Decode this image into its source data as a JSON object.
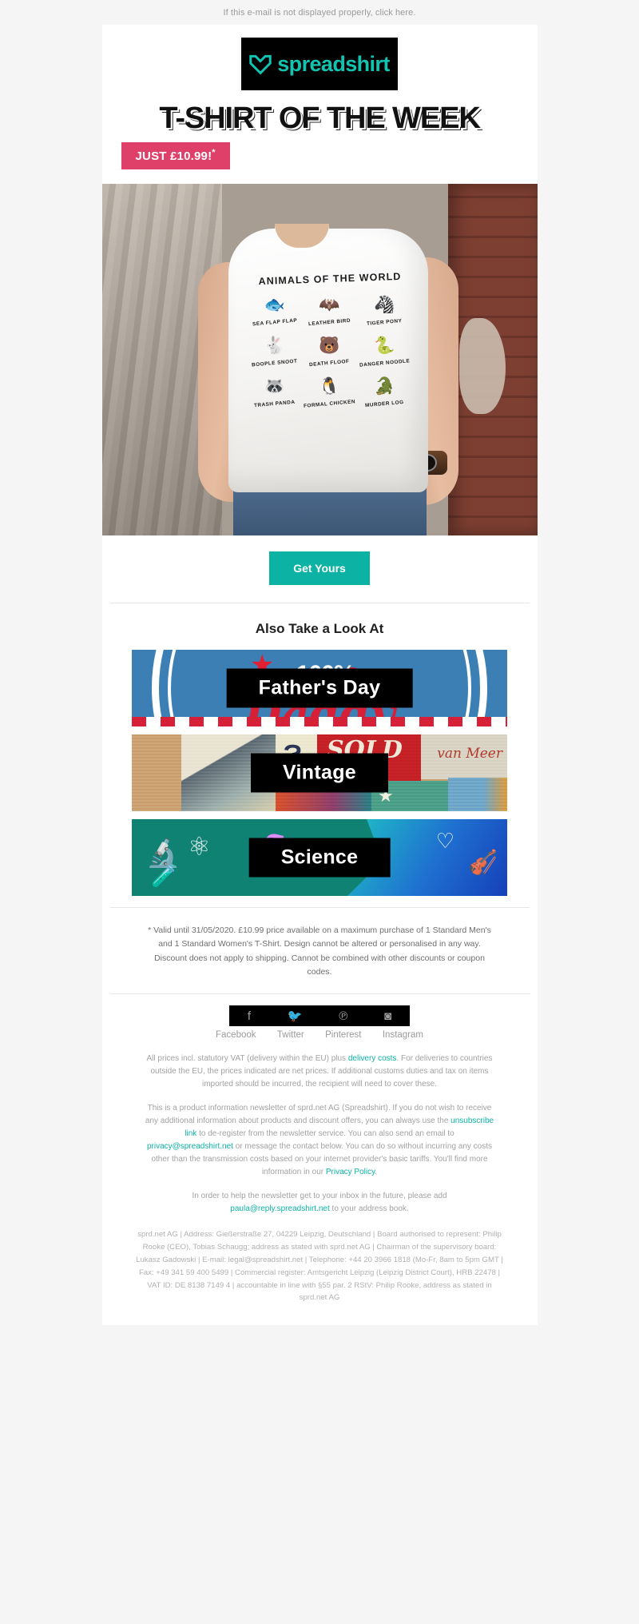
{
  "preheader": {
    "text": "If this e-mail is not displayed properly, ",
    "link": "click here."
  },
  "brand": {
    "name": "spreadshirt",
    "logo_icon": "spreadshirt-heart-logo",
    "accent_teal": "#0cb3a4",
    "accent_pink": "#de4069"
  },
  "hero": {
    "headline": "T-SHIRT OF THE WEEK",
    "badge": "JUST £10.99!",
    "badge_asterisk": "*",
    "cta_label": "Get Yours",
    "shirt_print": {
      "title": "ANIMALS OF THE WORLD",
      "items": [
        {
          "label": "SEA FLAP FLAP",
          "icon": "stingray-icon",
          "glyph": "🐟"
        },
        {
          "label": "LEATHER BIRD",
          "icon": "bat-icon",
          "glyph": "🦇"
        },
        {
          "label": "TIGER PONY",
          "icon": "zebra-icon",
          "glyph": "🦓"
        },
        {
          "label": "BOOPLE SNOOT",
          "icon": "rabbit-icon",
          "glyph": "🐇"
        },
        {
          "label": "DEATH FLOOF",
          "icon": "bear-icon",
          "glyph": "🐻"
        },
        {
          "label": "DANGER NOODLE",
          "icon": "snake-icon",
          "glyph": "🐍"
        },
        {
          "label": "TRASH PANDA",
          "icon": "raccoon-icon",
          "glyph": "🦝"
        },
        {
          "label": "FORMAL CHICKEN",
          "icon": "penguin-icon",
          "glyph": "🐧"
        },
        {
          "label": "MURDER LOG",
          "icon": "crocodile-icon",
          "glyph": "🐊"
        }
      ]
    }
  },
  "also": {
    "title": "Also Take a Look At",
    "banners": [
      {
        "label": "Father's Day",
        "art": "fathers-day",
        "art_text": "100%",
        "script_text": "Daddy",
        "bg": "#3b7fb5"
      },
      {
        "label": "Vintage",
        "art": "vintage-collage",
        "bg": "#cda272"
      },
      {
        "label": "Science",
        "art": "science-doodles",
        "bg": "#0f8273"
      }
    ]
  },
  "disclaimer": "* Valid until 31/05/2020. £10.99 price available on a maximum purchase of 1 Standard Men's and 1 Standard Women's T-Shirt. Design cannot be altered or personalised in any way. Discount does not apply to shipping. Cannot be combined with other discounts or coupon codes.",
  "social": [
    {
      "name": "Facebook",
      "icon": "facebook-icon",
      "glyph": "f"
    },
    {
      "name": "Twitter",
      "icon": "twitter-icon",
      "glyph": "🐦"
    },
    {
      "name": "Pinterest",
      "icon": "pinterest-icon",
      "glyph": "℗"
    },
    {
      "name": "Instagram",
      "icon": "instagram-icon",
      "glyph": "◙"
    }
  ],
  "footer": {
    "vat_1": "All prices incl. statutory VAT (delivery within the EU) plus ",
    "vat_link": "delivery costs",
    "vat_2": ". For deliveries to countries outside the EU, the prices indicated are net prices. If additional customs duties and tax on items imported should be incurred, the recipient will need to cover these.",
    "news_1": "This is a product information newsletter of sprd.net AG (Spreadshirt). If you do not wish to receive any additional information about products and discount offers, you can always use the ",
    "news_link_1": "unsubscribe link",
    "news_2": " to de-register from the newsletter service. You can also send an email to ",
    "news_link_2": "privacy@spreadshirt.net",
    "news_3": " or message the contact below. You can do so without incurring any costs other than the transmission costs based on your internet provider's basic tariffs. You'll find more information in our ",
    "news_link_3": "Privacy Policy",
    "news_4": ".",
    "inbox_1": "In order to help the newsletter get to your inbox in the future, please add ",
    "inbox_link": "paula@reply.spreadshirt.net",
    "inbox_2": " to your address book.",
    "legal": "sprd.net AG | Address: Gießerstraße 27, 04229 Leipzig, Deutschland | Board authorised to represent: Philip Rooke (CEO), Tobias Schaugg; address as stated with sprd.net AG | Chairman of the supervisory board: Lukasz Gadowski | E-mail: legal@spreadshirt.net | Telephone: +44 20 3966 1818 (Mo-Fr, 8am to 5pm GMT | Fax: +49 341 59 400 5499 | Commercial register: Amtsgericht Leipzig (Leipzig District Court), HRB 22478 | VAT ID: DE 8138 7149 4 | accountable in line with §55 par. 2 RStV: Philip Rooke, address as stated in sprd.net AG"
  }
}
